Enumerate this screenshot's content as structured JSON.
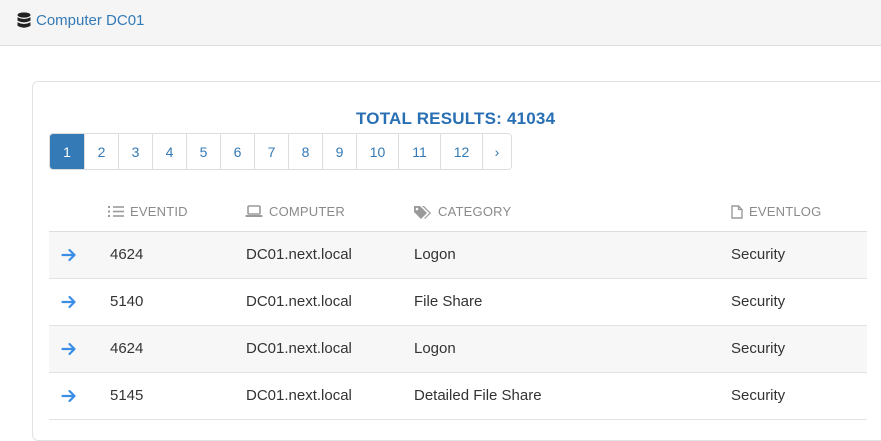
{
  "breadcrumb": {
    "label": "Computer DC01",
    "icon": "database-icon"
  },
  "results": {
    "total_label": "TOTAL RESULTS: 41034"
  },
  "pagination": {
    "pages": [
      "1",
      "2",
      "3",
      "4",
      "5",
      "6",
      "7",
      "8",
      "9",
      "10",
      "11",
      "12"
    ],
    "next": "›",
    "active_page": "1"
  },
  "table": {
    "columns": [
      {
        "label": "EVENTID",
        "icon": "list-ol-icon"
      },
      {
        "label": "COMPUTER",
        "icon": "laptop-icon"
      },
      {
        "label": "CATEGORY",
        "icon": "tags-icon"
      },
      {
        "label": "EVENTLOG",
        "icon": "file-icon"
      }
    ],
    "rows": [
      {
        "eventid": "4624",
        "computer": "DC01.next.local",
        "category": "Logon",
        "eventlog": "Security"
      },
      {
        "eventid": "5140",
        "computer": "DC01.next.local",
        "category": "File Share",
        "eventlog": "Security"
      },
      {
        "eventid": "4624",
        "computer": "DC01.next.local",
        "category": "Logon",
        "eventlog": "Security"
      },
      {
        "eventid": "5145",
        "computer": "DC01.next.local",
        "category": "Detailed File Share",
        "eventlog": "Security"
      }
    ]
  },
  "colors": {
    "link": "#337ab7",
    "accent_blue": "#286fb4",
    "arrow": "#3a8ee6",
    "header_text": "#8a8a8a"
  }
}
